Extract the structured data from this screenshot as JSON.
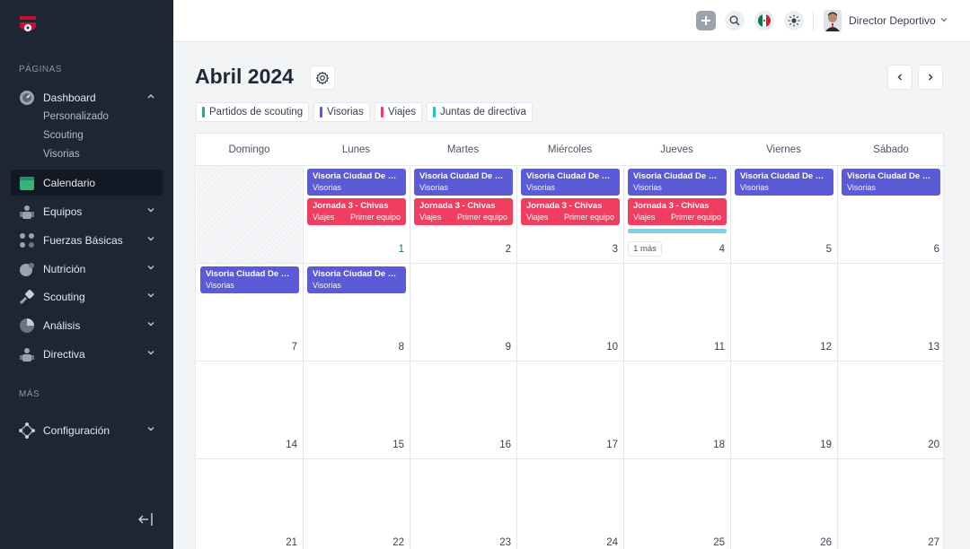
{
  "sidebar": {
    "section_pages": "PÁGINAS",
    "section_more": "MÁS",
    "dashboard": {
      "label": "Dashboard",
      "subs": [
        "Personalizado",
        "Scouting",
        "Visorias"
      ]
    },
    "items": [
      {
        "label": "Calendario",
        "icon": "calendar-icon"
      },
      {
        "label": "Equipos",
        "icon": "team-icon"
      },
      {
        "label": "Fuerzas Básicas",
        "icon": "nodes-icon"
      },
      {
        "label": "Nutrición",
        "icon": "nutrition-icon"
      },
      {
        "label": "Scouting",
        "icon": "scouting-icon"
      },
      {
        "label": "Análisis",
        "icon": "pie-chart-icon"
      },
      {
        "label": "Directiva",
        "icon": "board-icon"
      }
    ],
    "config": {
      "label": "Configuración",
      "icon": "gear-nodes-icon"
    }
  },
  "topbar": {
    "user_name": "Director Deportivo"
  },
  "calendar": {
    "title": "Abril 2024",
    "legend": [
      {
        "label": "Partidos de scouting",
        "color": "#10b981"
      },
      {
        "label": "Visorias",
        "color": "#5b5bd6"
      },
      {
        "label": "Viajes",
        "color": "#ef3e5f"
      },
      {
        "label": "Juntas de directiva",
        "color": "#22c5c5"
      }
    ],
    "weekdays": [
      "Domingo",
      "Lunes",
      "Martes",
      "Miércoles",
      "Jueves",
      "Viernes",
      "Sábado"
    ],
    "weeks": [
      [
        "",
        "1",
        "2",
        "3",
        "4",
        "5",
        "6"
      ],
      [
        "7",
        "8",
        "9",
        "10",
        "11",
        "12",
        "13"
      ],
      [
        "14",
        "15",
        "16",
        "17",
        "18",
        "19",
        "20"
      ],
      [
        "21",
        "22",
        "23",
        "24",
        "25",
        "26",
        "27"
      ]
    ],
    "event_visoria": {
      "title": "Visoria Ciudad De México",
      "category": "Visorias"
    },
    "event_jornada": {
      "title": "Jornada 3 - Chivas",
      "category": "Viajes",
      "team": "Primer equipo"
    },
    "more_label": "1 más"
  }
}
